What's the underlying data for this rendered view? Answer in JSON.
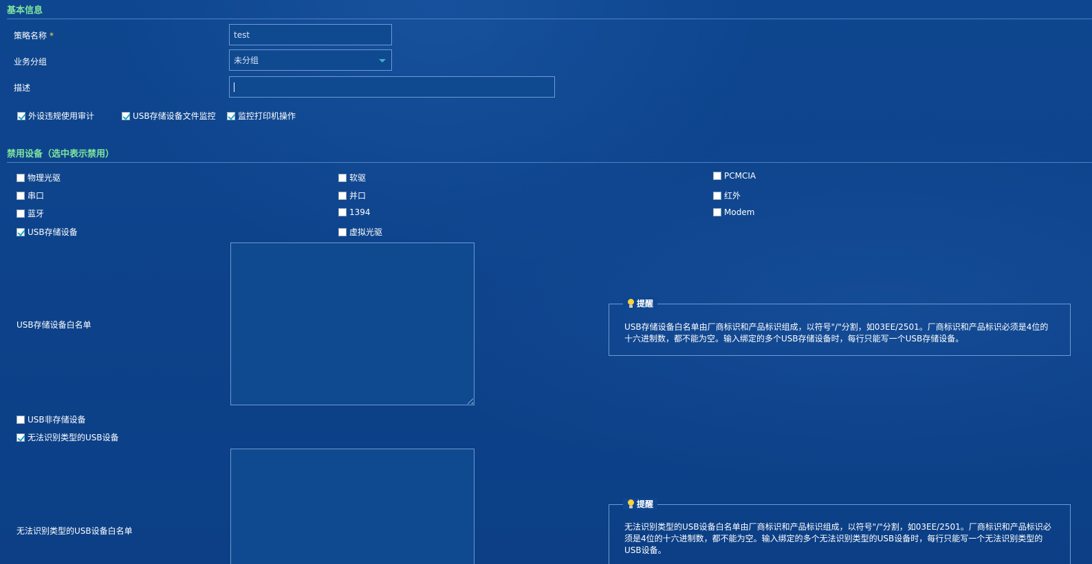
{
  "basic": {
    "section_title": "基本信息",
    "policy_name_label": "策略名称",
    "required_mark": "*",
    "policy_name_value": "test",
    "group_label": "业务分组",
    "group_value": "未分组",
    "desc_label": "描述",
    "desc_value": "",
    "options": [
      {
        "label": "外设违规使用审计",
        "checked": true
      },
      {
        "label": "USB存储设备文件监控",
        "checked": true
      },
      {
        "label": "监控打印机操作",
        "checked": true
      }
    ]
  },
  "disabled": {
    "section_title": "禁用设备（选中表示禁用）",
    "devices": {
      "optical": {
        "label": "物理光驱",
        "checked": false
      },
      "floppy": {
        "label": "软驱",
        "checked": false
      },
      "pcmcia": {
        "label": "PCMCIA",
        "checked": false
      },
      "serial": {
        "label": "串口",
        "checked": false
      },
      "parallel": {
        "label": "并口",
        "checked": false
      },
      "infrared": {
        "label": "红外",
        "checked": false
      },
      "bluetooth": {
        "label": "蓝牙",
        "checked": false
      },
      "firewire": {
        "label": "1394",
        "checked": false
      },
      "modem": {
        "label": "Modem",
        "checked": false
      },
      "usb_storage": {
        "label": "USB存储设备",
        "checked": true
      },
      "virtual_optical": {
        "label": "虚拟光驱",
        "checked": false
      },
      "usb_non_storage": {
        "label": "USB非存储设备",
        "checked": false
      },
      "usb_unknown": {
        "label": "无法识别类型的USB设备",
        "checked": true
      }
    },
    "usb_whitelist_label": "USB存储设备白名单",
    "unknown_whitelist_label": "无法识别类型的USB设备白名单",
    "tip1": {
      "title": "提醒",
      "text": "USB存储设备白名单由厂商标识和产品标识组成，以符号\"/\"分割，如03EE/2501。厂商标识和产品标识必须是4位的十六进制数，都不能为空。输入绑定的多个USB存储设备时，每行只能写一个USB存储设备。"
    },
    "tip2": {
      "title": "提醒",
      "text": "无法识别类型的USB设备白名单由厂商标识和产品标识组成，以符号\"/\"分割，如03EE/2501。厂商标识和产品标识必须是4位的十六进制数，都不能为空。输入绑定的多个无法识别类型的USB设备时，每行只能写一个无法识别类型的USB设备。"
    }
  },
  "icons": {
    "tip": "lightbulb-icon",
    "select": "chevron-down-icon"
  }
}
